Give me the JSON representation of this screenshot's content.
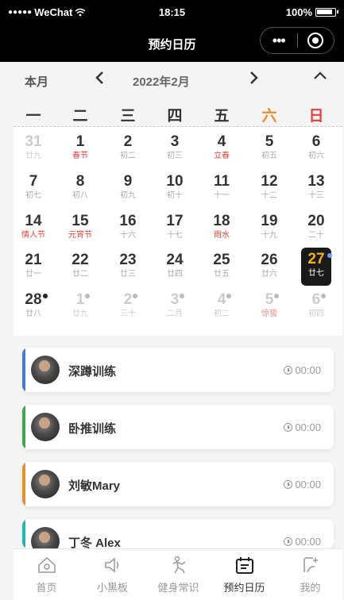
{
  "status_bar": {
    "carrier": "WeChat",
    "time": "18:15",
    "battery": "100%"
  },
  "nav": {
    "title": "预约日历",
    "more_label": "•••"
  },
  "calendar": {
    "month_label": "本月",
    "year_month": "2022年2月",
    "prev": "‹",
    "next": "›",
    "collapse": "⌃",
    "weekdays": [
      "一",
      "二",
      "三",
      "四",
      "五",
      "六",
      "日"
    ],
    "weekday_colors": {
      "weekday": "#333333",
      "saturday": "#f08c2b",
      "sunday": "#e3423a"
    },
    "weeks": [
      [
        {
          "day": "31",
          "lunar": "廿九",
          "dim": true
        },
        {
          "day": "1",
          "lunar": "春节",
          "style": "red"
        },
        {
          "day": "2",
          "lunar": "初二"
        },
        {
          "day": "3",
          "lunar": "初三"
        },
        {
          "day": "4",
          "lunar": "立春",
          "style": "red"
        },
        {
          "day": "5",
          "lunar": "初五"
        },
        {
          "day": "6",
          "lunar": "初六"
        }
      ],
      [
        {
          "day": "7",
          "lunar": "初七"
        },
        {
          "day": "8",
          "lunar": "初八"
        },
        {
          "day": "9",
          "lunar": "初九"
        },
        {
          "day": "10",
          "lunar": "初十"
        },
        {
          "day": "11",
          "lunar": "十一"
        },
        {
          "day": "12",
          "lunar": "十二"
        },
        {
          "day": "13",
          "lunar": "十三"
        }
      ],
      [
        {
          "day": "14",
          "lunar": "情人节",
          "style": "red"
        },
        {
          "day": "15",
          "lunar": "元宵节",
          "style": "red"
        },
        {
          "day": "16",
          "lunar": "十六"
        },
        {
          "day": "17",
          "lunar": "十七"
        },
        {
          "day": "18",
          "lunar": "雨水",
          "style": "red"
        },
        {
          "day": "19",
          "lunar": "十九"
        },
        {
          "day": "20",
          "lunar": "二十"
        }
      ],
      [
        {
          "day": "21",
          "lunar": "廿一"
        },
        {
          "day": "22",
          "lunar": "廿二"
        },
        {
          "day": "23",
          "lunar": "廿三"
        },
        {
          "day": "24",
          "lunar": "廿四"
        },
        {
          "day": "25",
          "lunar": "廿五"
        },
        {
          "day": "26",
          "lunar": "廿六"
        },
        {
          "day": "27",
          "lunar": "廿七",
          "today": true,
          "mark": "blue"
        }
      ],
      [
        {
          "day": "28",
          "lunar": "廿八",
          "mark": "dark"
        },
        {
          "day": "1",
          "lunar": "廿九",
          "dim": true,
          "mark": "grey"
        },
        {
          "day": "2",
          "lunar": "三十",
          "dim": true,
          "mark": "grey"
        },
        {
          "day": "3",
          "lunar": "二月",
          "dim": true,
          "mark": "grey"
        },
        {
          "day": "4",
          "lunar": "初二",
          "dim": true,
          "mark": "grey"
        },
        {
          "day": "5",
          "lunar": "惊蛰",
          "dim": true,
          "mark": "grey",
          "style": "pink"
        },
        {
          "day": "6",
          "lunar": "初四",
          "dim": true,
          "mark": "grey"
        }
      ]
    ]
  },
  "appointments": [
    {
      "name": "深蹲训练",
      "time": "00:00",
      "color": "#3b7ddd",
      "avatar": "avatar-icon"
    },
    {
      "name": "卧推训练",
      "time": "00:00",
      "color": "#2fb14a",
      "avatar": "avatar-icon"
    },
    {
      "name": "刘敏Mary",
      "time": "00:00",
      "color": "#f08c2b",
      "avatar": "avatar-icon"
    },
    {
      "name": "丁冬 Alex",
      "time": "00:00",
      "color": "#21b7b2",
      "avatar": "avatar-icon"
    }
  ],
  "tabbar": {
    "tabs": [
      {
        "label": "首页",
        "icon": "home-icon"
      },
      {
        "label": "小黑板",
        "icon": "megaphone-icon"
      },
      {
        "label": "健身常识",
        "icon": "body-icon"
      },
      {
        "label": "预约日历",
        "icon": "calendar-icon",
        "active": true
      },
      {
        "label": "我的",
        "icon": "profile-icon"
      }
    ]
  }
}
